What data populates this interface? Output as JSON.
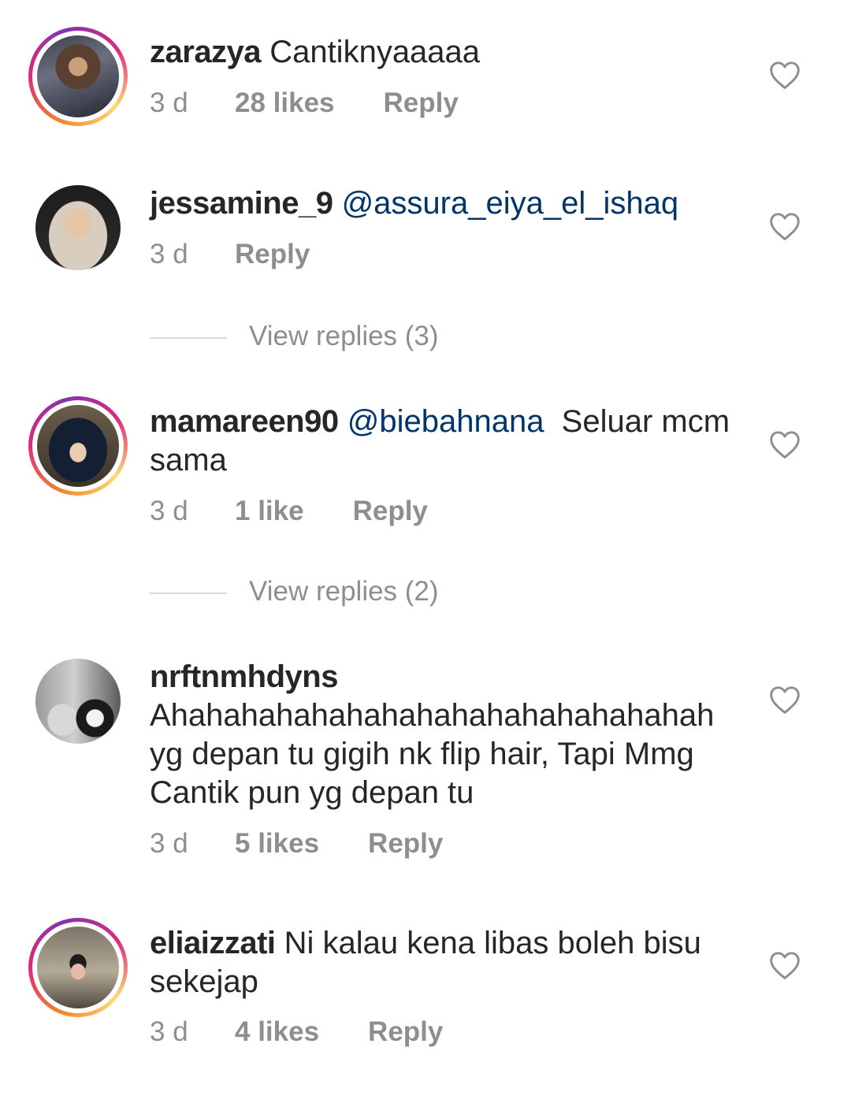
{
  "comments": [
    {
      "username": "zarazya",
      "mention": "",
      "text": "Cantiknyaaaaa",
      "time": "3 d",
      "likes": "28 likes",
      "reply": "Reply",
      "story_ring": true
    },
    {
      "username": "jessamine_9",
      "mention": "@assura_eiya_el_ishaq",
      "text": "",
      "time": "3 d",
      "likes": "",
      "reply": "Reply",
      "story_ring": false,
      "view_replies": "View replies (3)"
    },
    {
      "username": "mamareen90",
      "mention": "@biebahnana",
      "text": "  Seluar mcm sama",
      "time": "3 d",
      "likes": "1 like",
      "reply": "Reply",
      "story_ring": true,
      "view_replies": "View replies (2)"
    },
    {
      "username": "nrftnmhdyns",
      "mention": "",
      "text": "Ahahahahahahahahahahahahahahahah yg depan tu gigih nk flip hair, Tapi Mmg Cantik pun yg depan tu",
      "time": "3 d",
      "likes": "5 likes",
      "reply": "Reply",
      "story_ring": false
    },
    {
      "username": "eliaizzati",
      "mention": "",
      "text": "Ni kalau kena libas boleh bisu sekejap",
      "time": "3 d",
      "likes": "4 likes",
      "reply": "Reply",
      "story_ring": true
    }
  ],
  "icons": {
    "like": "heart-outline-icon"
  },
  "colors": {
    "mention": "#003569",
    "meta": "#8e8e8e",
    "divider": "#dbdbdb"
  }
}
